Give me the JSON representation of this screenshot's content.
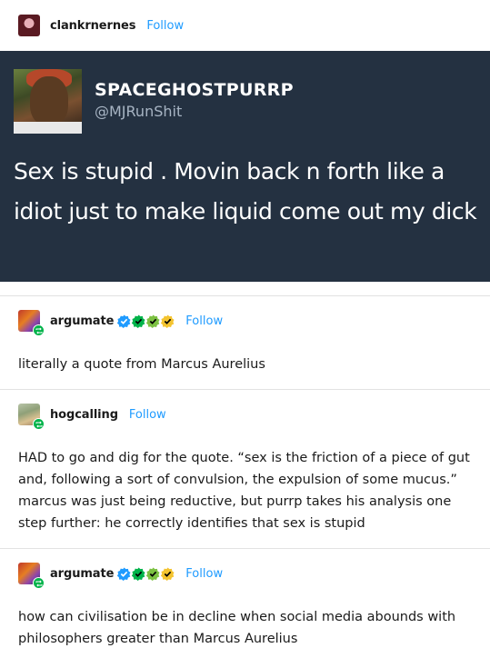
{
  "original_post": {
    "username": "clankrnernes",
    "follow_label": "Follow",
    "tweet": {
      "name": "SPACEGHOSTPURRP",
      "handle": "@MJRunShit",
      "text": "Sex is stupid . Movin back n forth like a idiot just to make liquid come out my dick"
    }
  },
  "reblogs": [
    {
      "username": "argumate",
      "follow_label": "Follow",
      "badge_colors": [
        "#1f9bff",
        "#00b34a",
        "#7cc142",
        "#f4c430"
      ],
      "text": "literally a quote from Marcus Aurelius"
    },
    {
      "username": "hogcalling",
      "follow_label": "Follow",
      "text": "HAD to go and dig for the quote. “sex is the friction of a piece of gut and, following a sort of convulsion, the expulsion of some mucus.” marcus was just being reductive, but purrp takes his analysis one step further: he correctly identifies that sex is stupid"
    },
    {
      "username": "argumate",
      "follow_label": "Follow",
      "badge_colors": [
        "#1f9bff",
        "#00b34a",
        "#7cc142",
        "#f4c430"
      ],
      "text": "how can civilisation be in decline when social media abounds with philosophers greater than Marcus Aurelius"
    }
  ],
  "colors": {
    "follow": "#1f9bff",
    "tweet_background": "#243141",
    "reblog_badge": "#00b34a"
  }
}
